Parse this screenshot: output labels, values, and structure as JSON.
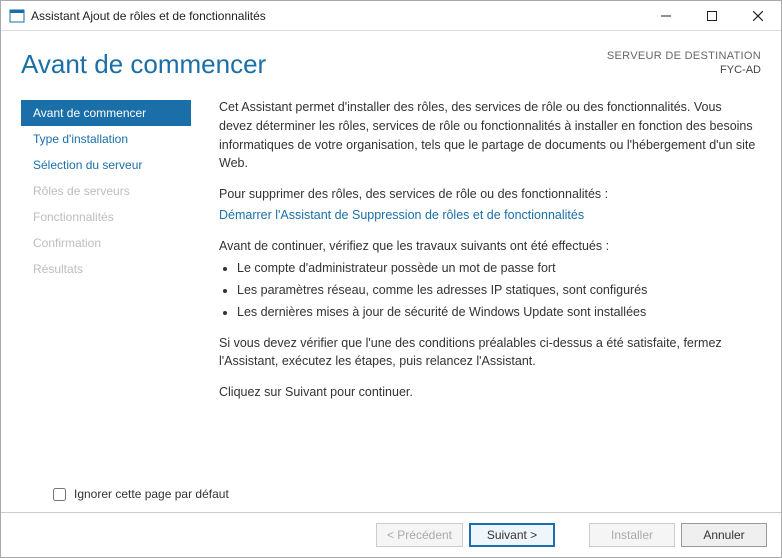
{
  "window": {
    "title": "Assistant Ajout de rôles et de fonctionnalités"
  },
  "header": {
    "title": "Avant de commencer",
    "destination_label": "SERVEUR DE DESTINATION",
    "destination_value": "FYC-AD"
  },
  "sidebar": {
    "items": [
      {
        "label": "Avant de commencer",
        "state": "selected"
      },
      {
        "label": "Type d'installation",
        "state": "enabled"
      },
      {
        "label": "Sélection du serveur",
        "state": "enabled"
      },
      {
        "label": "Rôles de serveurs",
        "state": "disabled"
      },
      {
        "label": "Fonctionnalités",
        "state": "disabled"
      },
      {
        "label": "Confirmation",
        "state": "disabled"
      },
      {
        "label": "Résultats",
        "state": "disabled"
      }
    ]
  },
  "content": {
    "intro": "Cet Assistant permet d'installer des rôles, des services de rôle ou des fonctionnalités. Vous devez déterminer les rôles, services de rôle ou fonctionnalités à installer en fonction des besoins informatiques de votre organisation, tels que le partage de documents ou l'hébergement d'un site Web.",
    "remove_intro": "Pour supprimer des rôles, des services de rôle ou des fonctionnalités :",
    "remove_link": "Démarrer l'Assistant de Suppression de rôles et de fonctionnalités",
    "verify_intro": "Avant de continuer, vérifiez que les travaux suivants ont été effectués :",
    "bullets": [
      "Le compte d'administrateur possède un mot de passe fort",
      "Les paramètres réseau, comme les adresses IP statiques, sont configurés",
      "Les dernières mises à jour de sécurité de Windows Update sont installées"
    ],
    "closing": "Si vous devez vérifier que l'une des conditions préalables ci-dessus a été satisfaite, fermez l'Assistant, exécutez les étapes, puis relancez l'Assistant.",
    "continue_hint": "Cliquez sur Suivant pour continuer.",
    "skip_checkbox_label": "Ignorer cette page par défaut",
    "skip_checked": false
  },
  "footer": {
    "previous": "< Précédent",
    "next": "Suivant >",
    "install": "Installer",
    "cancel": "Annuler"
  }
}
